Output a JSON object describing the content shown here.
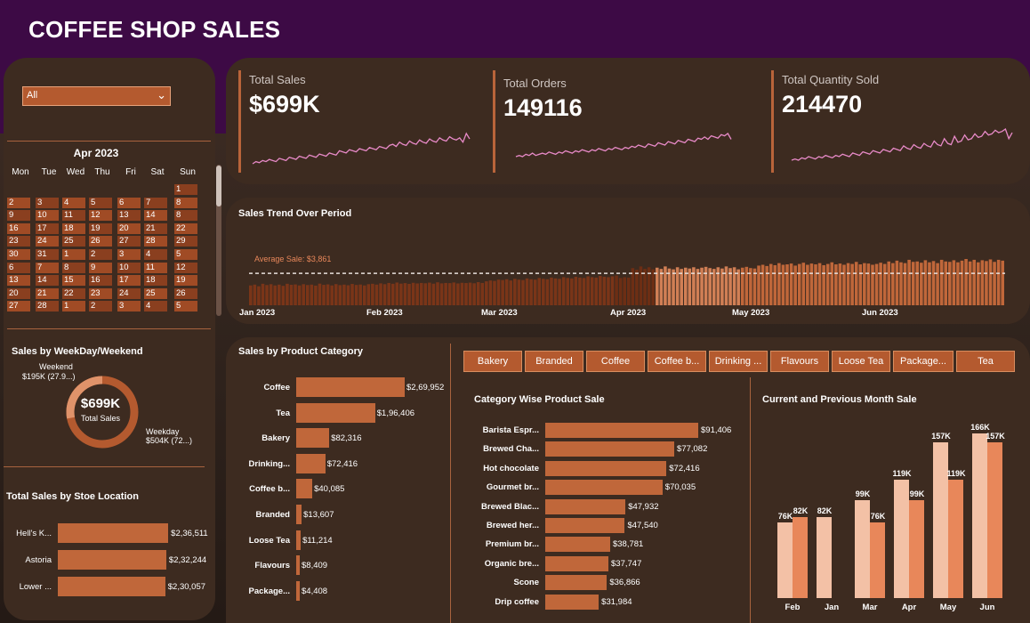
{
  "page_title": "COFFEE SHOP SALES",
  "filter": {
    "selected": "All"
  },
  "calendar": {
    "month": "Apr 2023",
    "weekdays": [
      "Mon",
      "Tue",
      "Wed",
      "Thu",
      "Fri",
      "Sat",
      "Sun"
    ],
    "weeks": [
      [
        "",
        "",
        "",
        "",
        "",
        "",
        "1"
      ],
      [
        "2",
        "3",
        "4",
        "5",
        "6",
        "7",
        "8"
      ],
      [
        "9",
        "10",
        "11",
        "12",
        "13",
        "14",
        "8"
      ],
      [
        "16",
        "17",
        "18",
        "19",
        "20",
        "21",
        "22"
      ],
      [
        "23",
        "24",
        "25",
        "26",
        "27",
        "28",
        "29"
      ],
      [
        "30",
        "31",
        "1",
        "2",
        "3",
        "4",
        "5"
      ],
      [
        "6",
        "7",
        "8",
        "9",
        "10",
        "11",
        "12"
      ],
      [
        "13",
        "14",
        "15",
        "16",
        "17",
        "18",
        "19"
      ],
      [
        "20",
        "21",
        "22",
        "23",
        "24",
        "25",
        "26"
      ],
      [
        "27",
        "28",
        "1",
        "2",
        "3",
        "4",
        "5"
      ]
    ]
  },
  "kpis": [
    {
      "label": "Total Sales",
      "value": "$699K"
    },
    {
      "label": "Total Orders",
      "value": "149116"
    },
    {
      "label": "Total Quantity Sold",
      "value": "214470"
    }
  ],
  "colors": {
    "accent": "#c0673a",
    "spark": "#e88ac8",
    "prev": "#f3c1a6",
    "curr": "#e8875a",
    "dark_bar": "#7a3518",
    "light_bar": "#d17f55"
  },
  "weekday_weekend": {
    "title": "Sales by WeekDay/Weekend",
    "center_value": "$699K",
    "center_label": "Total Sales",
    "weekend_label": "Weekend",
    "weekend_value": "$195K (27.9...)",
    "weekday_label": "Weekday",
    "weekday_value": "$504K (72...)",
    "weekend_share": 27.9
  },
  "store_location": {
    "title": "Total Sales by Stoe Location",
    "items": [
      {
        "label": "Hell's K...",
        "value": 236511,
        "text": "$2,36,511"
      },
      {
        "label": "Astoria",
        "value": 232244,
        "text": "$2,32,244"
      },
      {
        "label": "Lower ...",
        "value": 230057,
        "text": "$2,30,057"
      }
    ]
  },
  "product_tabs": [
    "Bakery",
    "Branded",
    "Coffee",
    "Coffee b...",
    "Drinking ...",
    "Flavours",
    "Loose Tea",
    "Package...",
    "Tea"
  ],
  "chart_data": [
    {
      "type": "bar",
      "title": "Sales Trend Over Period",
      "x_labels": [
        "Jan 2023",
        "Feb 2023",
        "Mar 2023",
        "Apr 2023",
        "May 2023",
        "Jun 2023"
      ],
      "average_label": "Average Sale: $3,861",
      "average": 3861,
      "daily_sales": [
        2400,
        2500,
        2300,
        2600,
        2450,
        2550,
        2400,
        2500,
        2350,
        2600,
        2480,
        2520,
        2400,
        2550,
        2450,
        2500,
        2380,
        2620,
        2470,
        2530,
        2400,
        2560,
        2440,
        2500,
        2420,
        2580,
        2460,
        2510,
        2400,
        2550,
        2600,
        2500,
        2650,
        2550,
        2700,
        2600,
        2750,
        2620,
        2680,
        2590,
        2720,
        2640,
        2700,
        2660,
        2740,
        2610,
        2780,
        2650,
        2700,
        2680,
        2760,
        2640,
        2720,
        2690,
        2740,
        2660,
        2800,
        2700,
        2900,
        3000,
        2950,
        3100,
        3050,
        3150,
        3000,
        3200,
        3100,
        3050,
        3250,
        3150,
        3100,
        3300,
        3200,
        3150,
        3350,
        3250,
        3200,
        3400,
        3300,
        3250,
        3450,
        3350,
        3300,
        3500,
        3400,
        3350,
        3550,
        3450,
        3400,
        3500,
        3600,
        3300,
        3400,
        3350,
        4500,
        4300,
        4700,
        4400,
        4600,
        4350,
        4550,
        4400,
        4700,
        4450,
        4350,
        4600,
        4400,
        4550,
        4450,
        4600,
        4400,
        4550,
        4650,
        4500,
        4400,
        4600,
        4450,
        4700,
        4500,
        4600,
        4350,
        4550,
        4650,
        4500,
        4450,
        4800,
        4900,
        4750,
        5000,
        4850,
        5100,
        4900,
        4950,
        5050,
        4800,
        5000,
        5150,
        4900,
        5050,
        4950,
        5100,
        4850,
        5000,
        5200,
        4950,
        5050,
        4900,
        5100,
        5000,
        5250,
        4950,
        5100,
        5050,
        4900,
        5000,
        5150,
        5000,
        5300,
        5100,
        5400,
        5200,
        5100,
        5500,
        5250,
        5300,
        5150,
        5450,
        5200,
        5350,
        5100,
        5500,
        5300,
        5250,
        5450,
        5200,
        5400,
        5600,
        5300,
        5500,
        5200,
        5450,
        5350,
        5550,
        5250,
        5500,
        5400
      ],
      "highlight_month": "Apr 2023"
    },
    {
      "type": "bar",
      "title": "Sales by Product Category",
      "categories": [
        "Coffee",
        "Tea",
        "Bakery",
        "Drinking...",
        "Coffee b...",
        "Branded",
        "Loose Tea",
        "Flavours",
        "Package..."
      ],
      "values": [
        269952,
        196406,
        82316,
        72416,
        40085,
        13607,
        11214,
        8409,
        4408
      ],
      "value_labels": [
        "$2,69,952",
        "$1,96,406",
        "$82,316",
        "$72,416",
        "$40,085",
        "$13,607",
        "$11,214",
        "$8,409",
        "$4,408"
      ]
    },
    {
      "type": "bar",
      "title": "Category Wise Product Sale",
      "categories": [
        "Barista Espr...",
        "Brewed Cha...",
        "Hot chocolate",
        "Gourmet br...",
        "Brewed Blac...",
        "Brewed her...",
        "Premium br...",
        "Organic bre...",
        "Scone",
        "Drip coffee"
      ],
      "values": [
        91406,
        77082,
        72416,
        70035,
        47932,
        47540,
        38781,
        37747,
        36866,
        31984
      ],
      "value_labels": [
        "$91,406",
        "$77,082",
        "$72,416",
        "$70,035",
        "$47,932",
        "$47,540",
        "$38,781",
        "$37,747",
        "$36,866",
        "$31,984"
      ]
    },
    {
      "type": "bar",
      "title": "Current and Previous Month Sale",
      "categories": [
        "Feb",
        "Jan",
        "Mar",
        "Apr",
        "May",
        "Jun"
      ],
      "series": [
        {
          "values": [
            76,
            82,
            99,
            119,
            157,
            166
          ],
          "labels": [
            "76K",
            "82K",
            "99K",
            "119K",
            "157K",
            "166K"
          ]
        },
        {
          "values": [
            82,
            null,
            76,
            99,
            119,
            157
          ],
          "labels": [
            "82K",
            "",
            "76K",
            "99K",
            "119K",
            "157K"
          ]
        }
      ]
    }
  ],
  "sparklines": {
    "sales": [
      10,
      12,
      11,
      13,
      12,
      14,
      13,
      12,
      15,
      14,
      13,
      16,
      15,
      14,
      17,
      16,
      15,
      18,
      17,
      16,
      19,
      18,
      17,
      20,
      19,
      18,
      22,
      21,
      20,
      23,
      22,
      21,
      24,
      23,
      22,
      25,
      24,
      23,
      26,
      25,
      24,
      27,
      28,
      26,
      30,
      28,
      27,
      31,
      29,
      28,
      32,
      30,
      29,
      33,
      31,
      30,
      34,
      32,
      31,
      35,
      33,
      32,
      34,
      30,
      38,
      33
    ],
    "orders": [
      12,
      13,
      12,
      14,
      13,
      15,
      13,
      14,
      15,
      14,
      16,
      15,
      14,
      16,
      15,
      17,
      16,
      15,
      17,
      16,
      18,
      17,
      16,
      18,
      17,
      19,
      18,
      17,
      19,
      18,
      20,
      19,
      18,
      20,
      19,
      21,
      20,
      22,
      21,
      20,
      23,
      22,
      21,
      24,
      23,
      22,
      25,
      24,
      23,
      26,
      25,
      24,
      27,
      26,
      25,
      28,
      27,
      29,
      27,
      30,
      29,
      28,
      31,
      30,
      32,
      27
    ],
    "qty": [
      10,
      11,
      10,
      12,
      11,
      13,
      12,
      11,
      13,
      12,
      14,
      13,
      12,
      14,
      13,
      15,
      14,
      13,
      16,
      15,
      14,
      17,
      16,
      15,
      18,
      17,
      16,
      19,
      18,
      17,
      20,
      19,
      18,
      22,
      20,
      19,
      23,
      21,
      20,
      24,
      22,
      21,
      26,
      23,
      22,
      28,
      24,
      23,
      30,
      25,
      26,
      31,
      27,
      28,
      32,
      29,
      30,
      34,
      31,
      32,
      35,
      33,
      34,
      36,
      28,
      33
    ]
  }
}
